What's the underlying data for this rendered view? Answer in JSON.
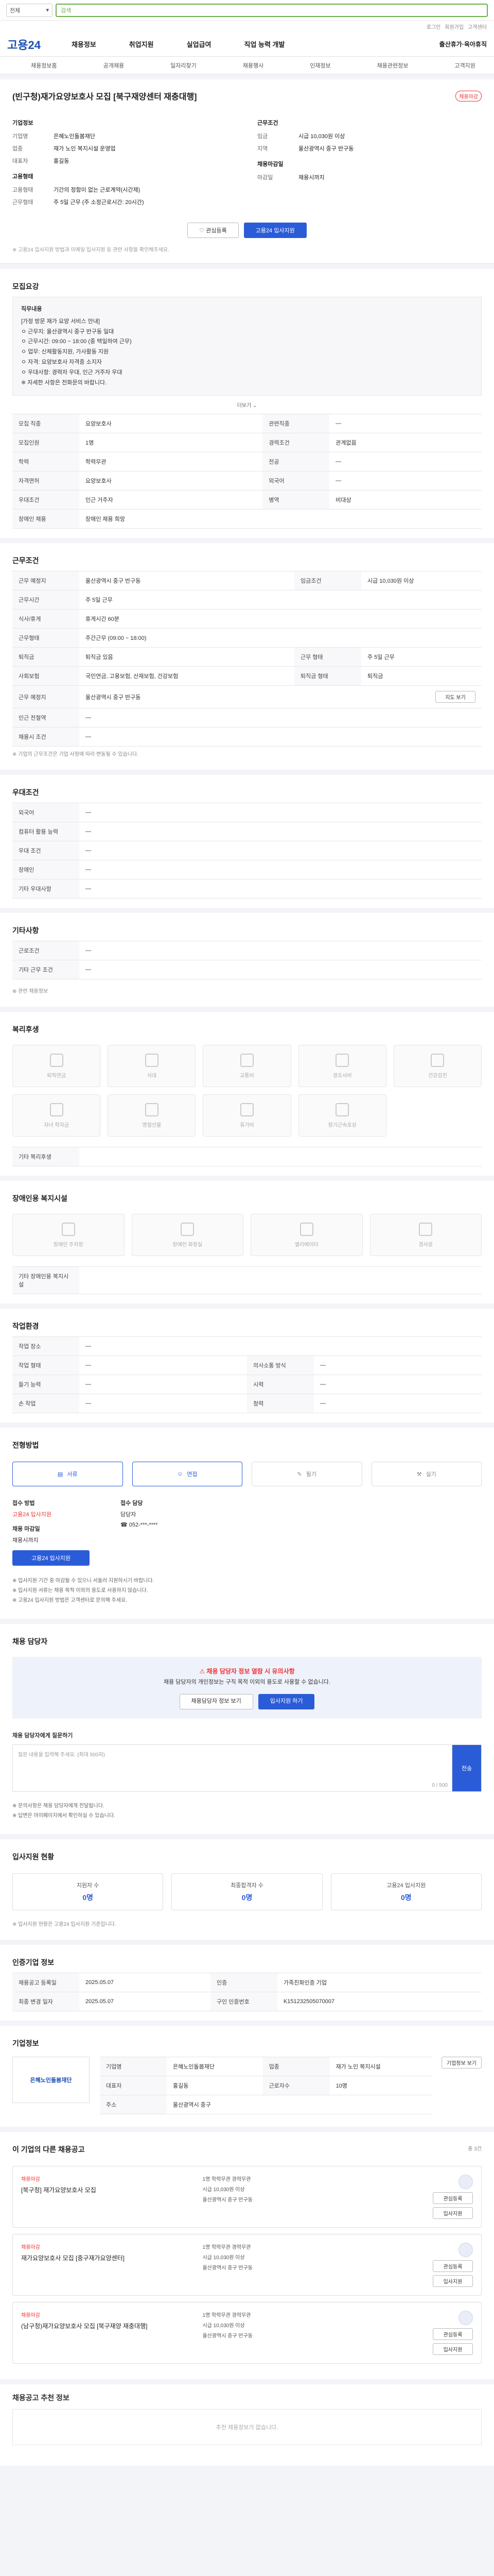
{
  "search": {
    "select_label": "전체",
    "placeholder": "검색"
  },
  "util": {
    "links": [
      "로그인",
      "회원가입",
      "고객센터"
    ]
  },
  "header": {
    "logo": "고용24",
    "menu": [
      "채용정보",
      "취업지원",
      "실업급여",
      "직업 능력 개발"
    ],
    "right": "출산휴가·육아휴직"
  },
  "subnav": [
    "채용정보홈",
    "공개채용",
    "일자리찾기",
    "채용행사",
    "인재정보",
    "채용관련정보",
    "고객지원"
  ],
  "job": {
    "title": "(빈구청)재가요양보호사 모집 [북구재양센터 재충대행]",
    "badge": "채용마감",
    "company_section": "기업정보",
    "company_fields": [
      {
        "k": "기업명",
        "v": "은혜노인돌봄재단"
      },
      {
        "k": "업종",
        "v": "재가 노인 복지시설 운영업"
      },
      {
        "k": "대표자",
        "v": "홍길동"
      }
    ],
    "cond_section": "근무조건",
    "cond_fields": [
      {
        "k": "임금",
        "v": "시급 10,030원 이상"
      },
      {
        "k": "지역",
        "v": "울산광역시 중구 반구동"
      }
    ],
    "work_section": "고용형태",
    "work_fields": [
      {
        "k": "고용형태",
        "v": "기간의 정함이 없는 근로계약(시간제)"
      },
      {
        "k": "근무형태",
        "v": "주 5일 근무 (주 소정근로시간: 20시간)"
      }
    ],
    "apply_section": "채용마감일",
    "apply_fields": [
      {
        "k": "마감일",
        "v": "채용시까지"
      }
    ],
    "btn_save": "관심등록",
    "btn_apply": "고용24 입사지원",
    "note": "※ 고용24 입사지원 방법과 이메일 입사지원 등 관련 사항을 확인해주세요."
  },
  "recruit": {
    "title": "모집요강",
    "desc_title": "직무내용",
    "desc_lines": [
      "[가정 방문 재가 요양 서비스 안내]",
      "ㅇ 근무지: 울산광역시 중구 반구동 일대",
      "ㅇ 근무시간: 09:00 ~ 18:00 (중 택일하여 근무)",
      "ㅇ 업무: 신체활동지원, 가사활동 지원",
      "ㅇ 자격: 요양보호사 자격증 소지자",
      "ㅇ 우대사항: 경력자 우대, 인근 거주자 우대",
      "※ 자세한 사항은 전화문의 바랍니다."
    ],
    "more": "더보기",
    "rows": [
      {
        "k": "모집 직종",
        "v": "요양보호사",
        "k2": "관련직종",
        "v2": "—"
      },
      {
        "k": "모집인원",
        "v": "1명",
        "k2": "경력조건",
        "v2": "관계없음"
      },
      {
        "k": "학력",
        "v": "학력무관",
        "k2": "전공",
        "v2": "—"
      },
      {
        "k": "자격면허",
        "v": "요양보호사",
        "k2": "외국어",
        "v2": "—"
      },
      {
        "k": "우대조건",
        "v": "인근 거주자",
        "k2": "병역",
        "v2": "비대상"
      },
      {
        "k": "장애인 채용",
        "v": "장애인 채용 희망",
        "k2": "",
        "v2": ""
      }
    ]
  },
  "conditions": {
    "title": "근무조건",
    "rows": [
      {
        "k": "근무 예정지",
        "v": "울산광역시 중구 반구동",
        "k2": "임금조건",
        "v2": "시급 10,030원 이상"
      },
      {
        "k": "근무시간",
        "v": "주 5일 근무",
        "k2": "",
        "v2": ""
      },
      {
        "k": "식사/휴게",
        "v": "휴게시간 60분",
        "k2": "",
        "v2": ""
      },
      {
        "k": "근무형태",
        "v": "주간근무 (09:00 ~ 18:00)",
        "k2": "",
        "v2": ""
      },
      {
        "k": "퇴직금",
        "v": "퇴직금 있음",
        "k2": "근무 형태",
        "v2": "주 5일 근무"
      },
      {
        "k": "사회보험",
        "v": "국민연금, 고용보험, 산재보험, 건강보험",
        "k2": "퇴직금 형태",
        "v2": "퇴직금"
      },
      {
        "k": "근무 예정지",
        "v": "울산광역시 중구 반구동",
        "k2": "",
        "v2": ""
      },
      {
        "k": "인근 전철역",
        "v": "—",
        "k2": "",
        "v2": ""
      },
      {
        "k": "채용시 조건",
        "v": "—",
        "k2": "",
        "v2": ""
      }
    ],
    "map_btn": "지도 보기",
    "foot": "※ 기업의 근무조건은 기업 사정에 따라 변동될 수 있습니다."
  },
  "prefer": {
    "title": "우대조건",
    "rows": [
      {
        "k": "외국어",
        "v": "—"
      },
      {
        "k": "컴퓨터 활용 능력",
        "v": "—"
      },
      {
        "k": "우대 조건",
        "v": "—"
      },
      {
        "k": "장애인",
        "v": "—"
      },
      {
        "k": "기타 우대사항",
        "v": "—"
      }
    ]
  },
  "misc": {
    "title": "기타사항",
    "rows": [
      {
        "k": "근로조건",
        "v": "—"
      },
      {
        "k": "기타 근무 조건",
        "v": "—"
      }
    ],
    "link": "관련 채용정보"
  },
  "welfare": {
    "title": "복리후생",
    "items": [
      "퇴직연금",
      "식대",
      "교통비",
      "경조사비",
      "건강검진",
      "자녀 학자금",
      "명절선물",
      "휴가비",
      "장기근속포상",
      "기타"
    ],
    "etc_label": "기타 복리후생"
  },
  "disabled": {
    "title": "장애인용 복지시설",
    "items": [
      "장애인 주차장",
      "장애인 화장실",
      "엘리베이터",
      "경사로"
    ],
    "etc_label": "기타 장애인용 복지시설"
  },
  "env": {
    "title": "작업환경",
    "rows": [
      {
        "k": "작업 장소",
        "v": "—",
        "k2": "",
        "v2": ""
      },
      {
        "k": "작업 형태",
        "v": "—",
        "k2": "의사소통 방식",
        "v2": "—"
      },
      {
        "k": "들기 능력",
        "v": "—",
        "k2": "시력",
        "v2": "—"
      },
      {
        "k": "손 작업",
        "v": "—",
        "k2": "청력",
        "v2": "—"
      }
    ]
  },
  "process": {
    "title": "전형방법",
    "steps": [
      "서류",
      "면접",
      "필기",
      "실기"
    ],
    "apply_method_label": "접수 방법",
    "apply_method_value": "고용24 입사지원",
    "apply_date_label": "채용 마감일",
    "apply_date_value": "채용시까지",
    "contact_label": "접수 담당",
    "contact_value": "담당자",
    "phone": "052-***-****",
    "apply_btn": "고용24 입사지원",
    "notes": [
      "※ 입사지원 기간 중 마감될 수 있으니 서둘러 지원하시기 바랍니다.",
      "※ 입사지원 서류는 채용 목적 이외의 용도로 사용하지 않습니다.",
      "※ 고용24 입사지원 방법은 고객센터로 문의해 주세요."
    ]
  },
  "contact": {
    "title": "채용 담당자",
    "callout_title": "채용 담당자 정보 열람 시 유의사항",
    "callout_body": "채용 담당자의 개인정보는 구직 목적 이외의 용도로 사용할 수 없습니다.",
    "btn1": "채용담당자 정보 보기",
    "btn2": "입사지원 하기",
    "msg_title": "채용 담당자에게 질문하기",
    "msg_placeholder": "질문 내용을 입력해 주세요. (최대 500자)",
    "msg_count": "0 / 500",
    "msg_send": "전송",
    "msg_notes": [
      "※ 문의사항은 채용 담당자에게 전달됩니다.",
      "※ 답변은 마이페이지에서 확인하실 수 있습니다."
    ]
  },
  "status": {
    "title": "입사지원 현황",
    "items": [
      {
        "label": "지원자 수",
        "value": "0명"
      },
      {
        "label": "최종합격자 수",
        "value": "0명"
      },
      {
        "label": "고용24 입사지원",
        "value": "0명"
      }
    ],
    "note": "※ 입사지원 현황은 고용24 입사지원 기준입니다."
  },
  "meta": {
    "title": "인증기업 정보",
    "rows": [
      {
        "k": "채용공고 등록일",
        "v": "2025.05.07",
        "k2": "인증",
        "v2": "가족친화인증 기업"
      },
      {
        "k": "최종 변경 일자",
        "v": "2025.05.07",
        "k2": "구인 인증번호",
        "v2": "K151232505070007"
      }
    ]
  },
  "company": {
    "title": "기업정보",
    "name": "은혜노인돌봄재단",
    "fields": [
      {
        "k": "기업명",
        "v": "은혜노인돌봄재단",
        "k2": "업종",
        "v2": "재가 노인 복지시설"
      },
      {
        "k": "대표자",
        "v": "홍길동",
        "k2": "근로자수",
        "v2": "10명"
      },
      {
        "k": "주소",
        "v": "울산광역시 중구",
        "k2": "",
        "v2": ""
      }
    ],
    "link": "기업정보 보기"
  },
  "others": {
    "title": "이 기업의 다른 채용공고",
    "sub": "총 3건",
    "items": [
      {
        "comp": "채용마감",
        "title": "[북구청] 재가요양보호사 모집",
        "l1": "1명  학력무관  경력무관",
        "l2": "시급 10,030원 이상",
        "l3": "울산광역시 중구 반구동",
        "b1": "관심등록",
        "b2": "입사지원"
      },
      {
        "comp": "채용마감",
        "title": "재가요양보호사 모집 [중구재가요양센터]",
        "l1": "1명  학력무관  경력무관",
        "l2": "시급 10,030원 이상",
        "l3": "울산광역시 중구 반구동",
        "b1": "관심등록",
        "b2": "입사지원"
      },
      {
        "comp": "채용마감",
        "title": "(남구청)재가요양보호사 모집 [북구재양 재충대행]",
        "l1": "1명  학력무관  경력무관",
        "l2": "시급 10,030원 이상",
        "l3": "울산광역시 중구 반구동",
        "b1": "관심등록",
        "b2": "입사지원"
      }
    ]
  },
  "footer": {
    "title": "채용공고 추천 정보",
    "empty": "추천 채용정보가 없습니다."
  }
}
